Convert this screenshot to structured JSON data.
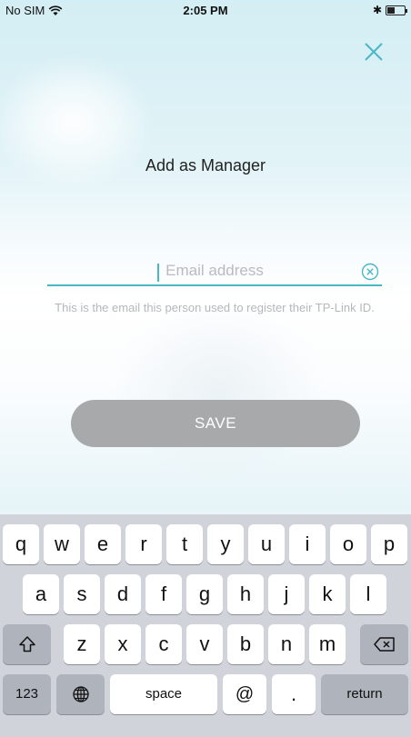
{
  "status_bar": {
    "carrier": "No SIM",
    "time": "2:05 PM",
    "bluetooth": "✱"
  },
  "header": {
    "title": "Add as Manager",
    "close_icon": "close-icon"
  },
  "form": {
    "email": {
      "value": "",
      "placeholder": "Email address",
      "clear_icon": "clear-circle-icon"
    },
    "helper_text": "This is the email this person used to register their TP-Link ID.",
    "save_label": "SAVE"
  },
  "colors": {
    "accent": "#4ab8c4",
    "save_button_disabled": "#a7a9ab",
    "keyboard_bg": "#d0d3d9"
  },
  "keyboard": {
    "row1": [
      "q",
      "w",
      "e",
      "r",
      "t",
      "y",
      "u",
      "i",
      "o",
      "p"
    ],
    "row2": [
      "a",
      "s",
      "d",
      "f",
      "g",
      "h",
      "j",
      "k",
      "l"
    ],
    "row3": [
      "z",
      "x",
      "c",
      "v",
      "b",
      "n",
      "m"
    ],
    "shift_icon": "shift-icon",
    "delete_icon": "backspace-icon",
    "numbers_label": "123",
    "globe_icon": "globe-icon",
    "space_label": "space",
    "at_label": "@",
    "dot_label": ".",
    "return_label": "return"
  }
}
